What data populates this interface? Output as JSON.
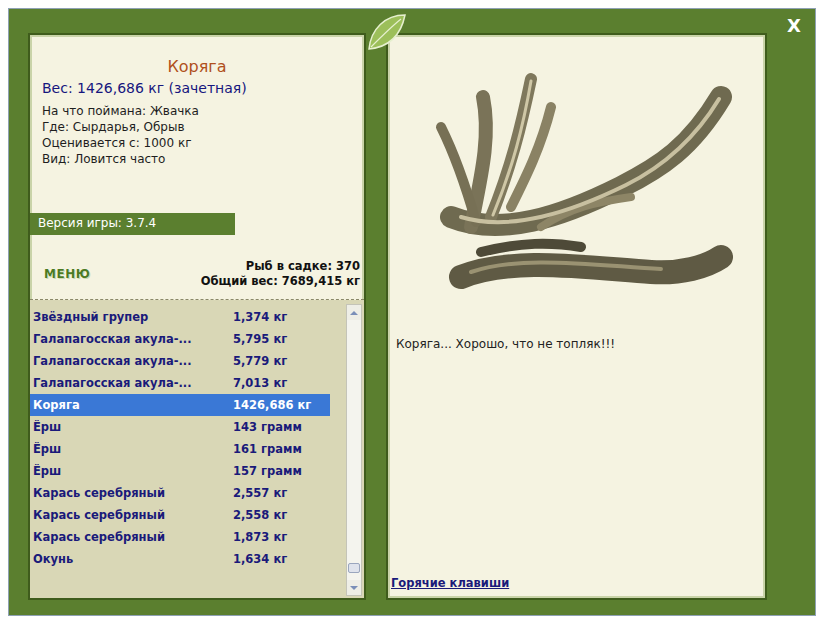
{
  "window": {
    "close": "X"
  },
  "catch": {
    "name": "Коряга",
    "weight": "Вес: 1426,686 кг (зачетная)",
    "details": [
      "На что поймана: Жвачка",
      "Где: Сырдарья, Обрыв",
      "Оценивается с: 1000 кг",
      "Вид: Ловится часто"
    ]
  },
  "version": "Версия игры: 3.7.4",
  "menu_button": "МЕНЮ",
  "keepnet": {
    "count": "Рыб в садке: 370",
    "total": "Общий вес: 7689,415 кг"
  },
  "fish_list": {
    "rows": [
      {
        "name": "Звёздный групер",
        "weight": "1,374 кг",
        "selected": false
      },
      {
        "name": "Галапагосская акула-...",
        "weight": "5,795 кг",
        "selected": false
      },
      {
        "name": "Галапагосская акула-...",
        "weight": "5,779 кг",
        "selected": false
      },
      {
        "name": "Галапагосская акула-...",
        "weight": "7,013 кг",
        "selected": false
      },
      {
        "name": "Коряга",
        "weight": "1426,686 кг",
        "selected": true
      },
      {
        "name": "Ёрш",
        "weight": "143 грамм",
        "selected": false
      },
      {
        "name": "Ёрш",
        "weight": "161 грамм",
        "selected": false
      },
      {
        "name": "Ёрш",
        "weight": "157 грамм",
        "selected": false
      },
      {
        "name": "Карась серебряный",
        "weight": "2,557 кг",
        "selected": false
      },
      {
        "name": "Карась серебряный",
        "weight": "2,558 кг",
        "selected": false
      },
      {
        "name": "Карась серебряный",
        "weight": "1,873 кг",
        "selected": false
      },
      {
        "name": "Окунь",
        "weight": "1,634 кг",
        "selected": false
      }
    ],
    "scroll_position": 0.97
  },
  "preview": {
    "caption": "Коряга... Хорошо, что не топляк!!!"
  },
  "hotkeys_link": "Горячие клавиши"
}
